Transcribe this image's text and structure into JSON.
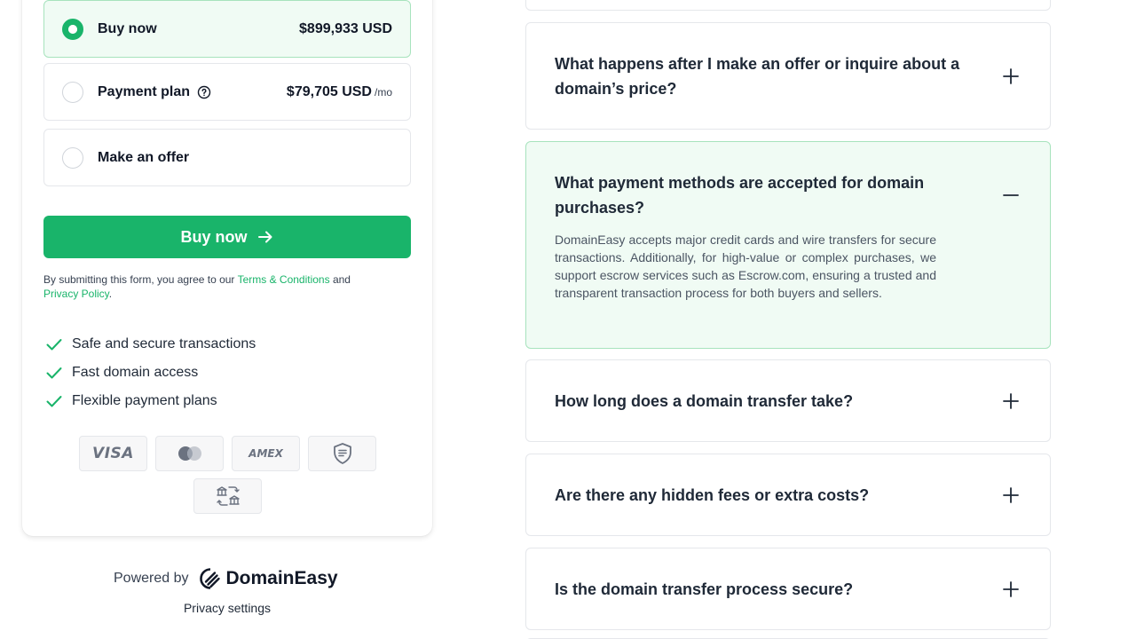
{
  "purchase": {
    "options": [
      {
        "label": "Buy now",
        "price": "$899,933 USD",
        "per": "",
        "selected": true
      },
      {
        "label": "Payment plan",
        "price": "$79,705 USD",
        "per": "/mo",
        "selected": false
      },
      {
        "label": "Make an offer",
        "price": "",
        "per": "",
        "selected": false
      }
    ],
    "cta_label": "Buy now",
    "terms": {
      "prefix": "By submitting this form, you agree to our ",
      "terms_link": "Terms & Conditions",
      "middle": " and",
      "privacy_link": "Privacy Policy",
      "suffix": "."
    },
    "benefits": [
      "Safe and secure transactions",
      "Fast domain access",
      "Flexible payment plans"
    ],
    "payment_methods": [
      {
        "name": "visa",
        "text": "VISA"
      },
      {
        "name": "mastercard",
        "text": ""
      },
      {
        "name": "amex",
        "text": "AMEX"
      },
      {
        "name": "escrow-shield",
        "text": ""
      },
      {
        "name": "bank-transfer",
        "text": ""
      }
    ]
  },
  "footer": {
    "powered_by": "Powered by",
    "brand": "DomainEasy",
    "privacy_settings": "Privacy settings"
  },
  "faq": [
    {
      "question": "What happens after I make an offer or inquire about a domain’s price?",
      "expanded": false
    },
    {
      "question": "What payment methods are accepted for domain purchases?",
      "expanded": true,
      "answer": "DomainEasy accepts major credit cards and wire transfers for secure transactions. Additionally, for high-value or complex purchases, we support escrow services such as Escrow.com, ensuring a trusted and transparent transaction process for both buyers and sellers."
    },
    {
      "question": "How long does a domain transfer take?",
      "expanded": false
    },
    {
      "question": "Are there any hidden fees or extra costs?",
      "expanded": false
    },
    {
      "question": "Is the domain transfer process secure?",
      "expanded": false
    }
  ],
  "colors": {
    "accent": "#19b46a",
    "accent_light": "#f0fbf4",
    "border": "#e5e7eb"
  },
  "icons": [
    "help-circle-icon",
    "arrow-right-icon",
    "check-icon",
    "plus-icon",
    "minus-icon",
    "domaineasy-logo-icon"
  ]
}
